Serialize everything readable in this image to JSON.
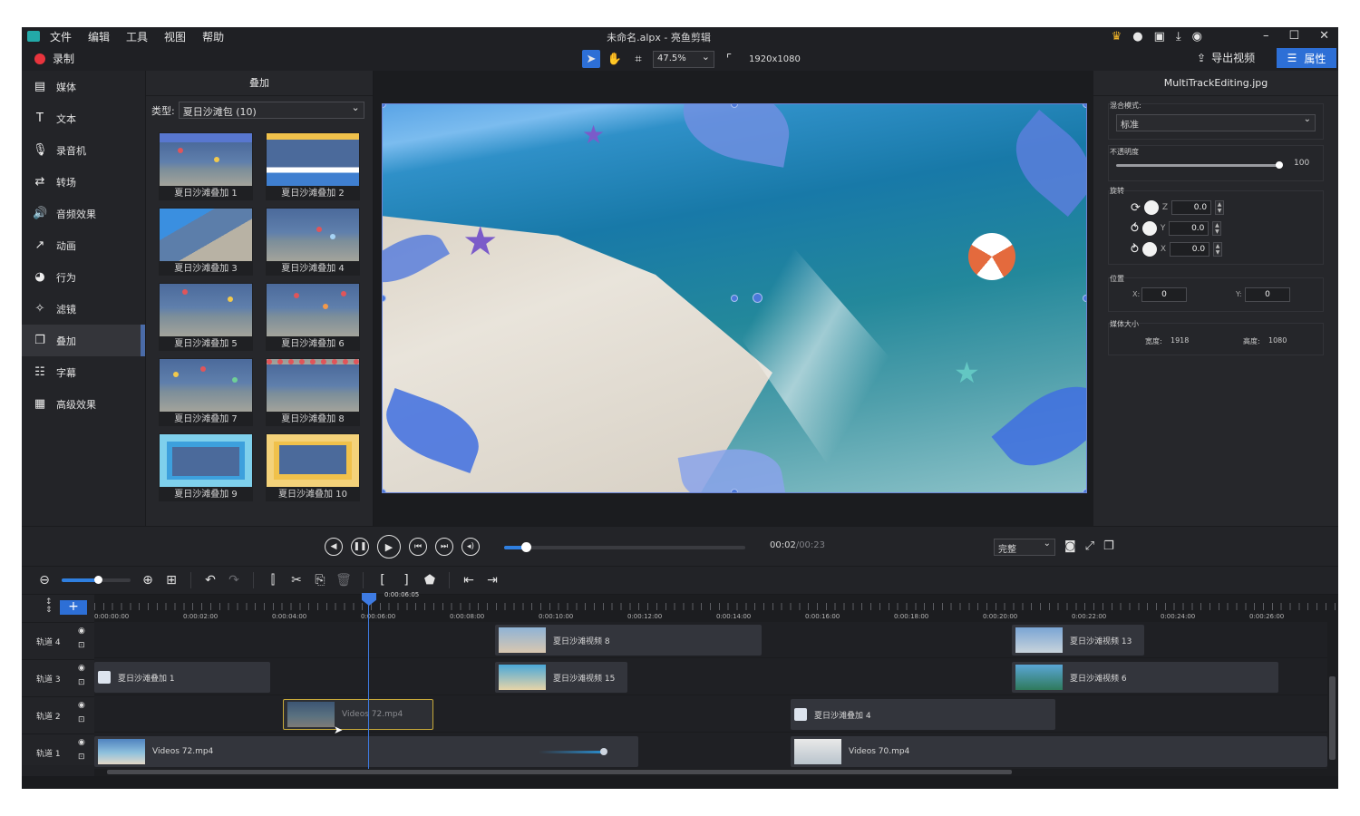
{
  "window": {
    "title": "未命名.alpx - 亮鱼剪辑",
    "menu": [
      "文件",
      "编辑",
      "工具",
      "视图",
      "帮助"
    ],
    "record_label": "录制",
    "export_label": "导出视频",
    "properties_label": "属性"
  },
  "view_toolbar": {
    "zoom": "47.5%",
    "resolution": "1920x1080"
  },
  "sidebar": {
    "items": [
      {
        "label": "媒体",
        "icon": "folder-icon"
      },
      {
        "label": "文本",
        "icon": "text-icon"
      },
      {
        "label": "录音机",
        "icon": "microphone-icon"
      },
      {
        "label": "转场",
        "icon": "transition-icon"
      },
      {
        "label": "音频效果",
        "icon": "speaker-icon"
      },
      {
        "label": "动画",
        "icon": "animation-arrow-icon"
      },
      {
        "label": "行为",
        "icon": "behavior-icon"
      },
      {
        "label": "滤镜",
        "icon": "magic-wand-icon"
      },
      {
        "label": "叠加",
        "icon": "overlay-icon"
      },
      {
        "label": "字幕",
        "icon": "subtitle-icon"
      },
      {
        "label": "高级效果",
        "icon": "film-icon"
      }
    ],
    "active": "叠加"
  },
  "overlay_panel": {
    "title": "叠加",
    "type_label": "类型:",
    "type_value": "夏日沙滩包 (10)",
    "items": [
      "夏日沙滩叠加 1",
      "夏日沙滩叠加 2",
      "夏日沙滩叠加 3",
      "夏日沙滩叠加 4",
      "夏日沙滩叠加 5",
      "夏日沙滩叠加 6",
      "夏日沙滩叠加 7",
      "夏日沙滩叠加 8",
      "夏日沙滩叠加 9",
      "夏日沙滩叠加 10"
    ]
  },
  "properties": {
    "file_name": "MultiTrackEditing.jpg",
    "blend_mode_label": "混合模式:",
    "blend_mode_value": "标准",
    "opacity_label": "不透明度",
    "opacity_value": "100",
    "opacity_level": 1.0,
    "rotation_label": "旋转",
    "rotation": [
      {
        "axis": "Z",
        "value": "0.0"
      },
      {
        "axis": "Y",
        "value": "0.0"
      },
      {
        "axis": "X",
        "value": "0.0"
      }
    ],
    "position_label": "位置",
    "position_x_label": "X:",
    "position_x": "0",
    "position_y_label": "Y:",
    "position_y": "0",
    "media_size_label": "媒体大小",
    "width_label": "宽度:",
    "width": "1918",
    "height_label": "高度:",
    "height": "1080"
  },
  "playback": {
    "current_time": "00:02",
    "total_time": "/00:23",
    "progress": 0.09,
    "quality": "完整"
  },
  "timeline": {
    "zoom_level": 0.52,
    "playhead_time": "0:00:06:05",
    "ruler": [
      "0:00:00:00",
      "0:00:02:00",
      "0:00:04:00",
      "0:00:06:00",
      "0:00:08:00",
      "0:00:10:00",
      "0:00:12:00",
      "0:00:14:00",
      "0:00:16:00",
      "0:00:18:00",
      "0:00:20:00",
      "0:00:22:00",
      "0:00:24:00",
      "0:00:26:00"
    ],
    "tracks": [
      {
        "name": "轨道 4",
        "clips": [
          {
            "label": "夏日沙滩视频 8",
            "type": "video"
          },
          {
            "label": "夏日沙滩视频 13",
            "type": "video"
          }
        ]
      },
      {
        "name": "轨道 3",
        "clips": [
          {
            "label": "夏日沙滩叠加 1",
            "type": "overlay"
          },
          {
            "label": "夏日沙滩视频 15",
            "type": "video"
          },
          {
            "label": "夏日沙滩视频 6",
            "type": "video"
          }
        ]
      },
      {
        "name": "轨道 2",
        "clips": [
          {
            "label": "Videos 72.mp4",
            "type": "video",
            "selected": true
          },
          {
            "label": "夏日沙滩叠加 4",
            "type": "overlay"
          }
        ]
      },
      {
        "name": "轨道 1",
        "clips": [
          {
            "label": "Videos 72.mp4",
            "type": "video"
          },
          {
            "label": "Videos 70.mp4",
            "type": "video"
          }
        ]
      }
    ]
  },
  "colors": {
    "accent": "#2d6fd6",
    "record": "#e8343d",
    "background": "#212226",
    "selected_clip_border": "#c7a93a"
  }
}
